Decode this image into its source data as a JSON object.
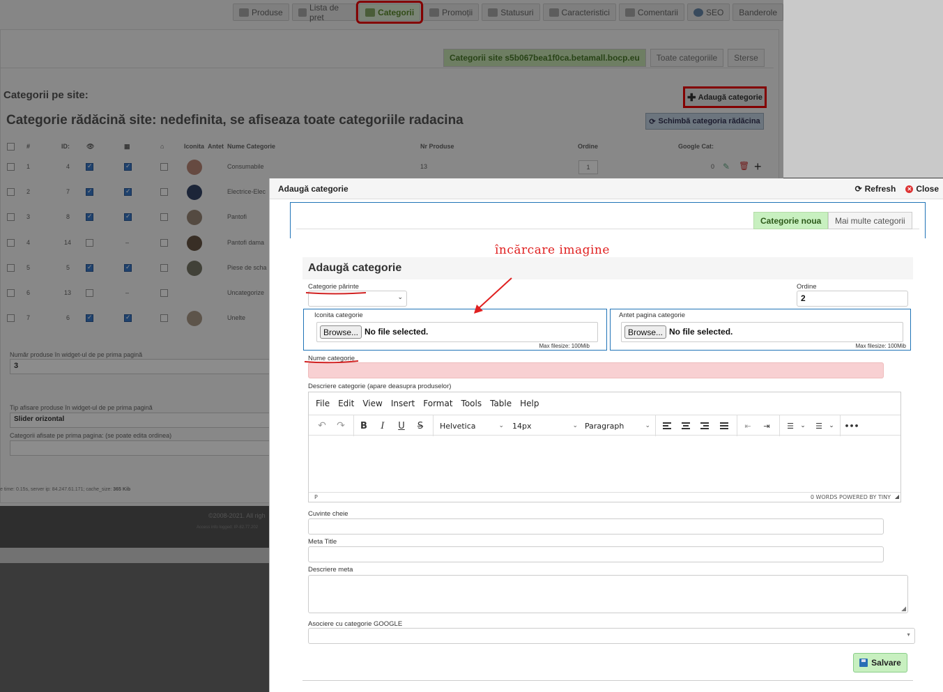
{
  "background": {
    "top_tabs": [
      {
        "label": "Produse",
        "icon": "box-icon"
      },
      {
        "label": "Lista de pret",
        "icon": "list-icon"
      },
      {
        "label": "Categorii",
        "icon": "category-icon",
        "active": true
      },
      {
        "label": "Promoții",
        "icon": "promo-icon"
      },
      {
        "label": "Statusuri",
        "icon": "tag-icon"
      },
      {
        "label": "Caracteristici",
        "icon": "chart-icon"
      },
      {
        "label": "Comentarii",
        "icon": "comment-icon"
      },
      {
        "label": "SEO",
        "icon": "globe-icon"
      },
      {
        "label": "Banderole",
        "icon": ""
      }
    ],
    "site_tabs": [
      "Categorii site s5b067bea1f0ca.betamall.bocp.eu",
      "Toate categoriile",
      "Sterse"
    ],
    "categories_label": "Categorii pe site:",
    "add_category_label": "Adaugă categorie",
    "root_title": "Categorie rădăcină site: nedefinita, se afiseaza toate categoriile radacina",
    "change_root_label": "Schimbă categoria rădăcina",
    "table_headers": {
      "num": "#",
      "id": "ID:",
      "icon_col": "Iconita",
      "header_col": "Antet",
      "name": "Nume Categorie",
      "count": "Nr Produse",
      "order": "Ordine",
      "google": "Google Cat:"
    },
    "rows": [
      {
        "num": "1",
        "id": "4",
        "visible": true,
        "featured": true,
        "home": false,
        "name": "Consumabile",
        "count": "13",
        "order": "1",
        "google": "0"
      },
      {
        "num": "2",
        "id": "7",
        "visible": true,
        "featured": true,
        "home": false,
        "name": "Electrice-Elec"
      },
      {
        "num": "3",
        "id": "8",
        "visible": true,
        "featured": true,
        "home": false,
        "name": "Pantofi"
      },
      {
        "num": "4",
        "id": "14",
        "visible": false,
        "featured": null,
        "home": false,
        "name": "Pantofi dama"
      },
      {
        "num": "5",
        "id": "5",
        "visible": true,
        "featured": true,
        "home": false,
        "name": "Piese de scha"
      },
      {
        "num": "6",
        "id": "13",
        "visible": false,
        "featured": null,
        "home": false,
        "name": "Uncategorize"
      },
      {
        "num": "7",
        "id": "6",
        "visible": true,
        "featured": true,
        "home": false,
        "name": "Unelte"
      }
    ],
    "widget_count_label": "Număr produse în widget-ul de pe prima pagină",
    "widget_count_value": "3",
    "widget_type_label": "Tip afisare produse în widget-ul de pe prima pagină",
    "widget_type_value": "Slider orizontal",
    "homepage_categories_label": "Categorii afisate pe prima pagina: (se poate edita ordinea)",
    "footer_info_prefix": "e time: 0.15s, server ip: 84.247.61.171; cache_size: ",
    "footer_info_size": "365 Kib",
    "copyright": "©2008-2021. All righ",
    "access_info": "Access info logged: IP-82.77.202"
  },
  "modal": {
    "title": "Adaugă categorie",
    "refresh_label": "Refresh",
    "close_label": "Close",
    "tabs": [
      "Categorie noua",
      "Mai multe categorii"
    ],
    "annotation": "încărcare imagine",
    "panel_title": "Adaugă categorie",
    "parent_label": "Categorie părinte",
    "parent_value": "",
    "order_label": "Ordine",
    "order_value": "2",
    "icon_label": "Iconita categorie",
    "header_label": "Antet pagina categorie",
    "browse_label": "Browse...",
    "no_file": "No file selected.",
    "max_filesize": "Max filesize: 100Mib",
    "name_label": "Nume categorie",
    "desc_label": "Descriere categorie (apare deasupra produselor)",
    "editor_menu": [
      "File",
      "Edit",
      "View",
      "Insert",
      "Format",
      "Tools",
      "Table",
      "Help"
    ],
    "font_family": "Helvetica",
    "font_size": "14px",
    "block_format": "Paragraph",
    "status_path": "P",
    "status_right": "0 WORDS  POWERED BY TINY",
    "keywords_label": "Cuvinte cheie",
    "meta_title_label": "Meta Title",
    "meta_desc_label": "Descriere meta",
    "google_label": "Asociere cu categorie GOOGLE",
    "save_label": "Salvare"
  }
}
